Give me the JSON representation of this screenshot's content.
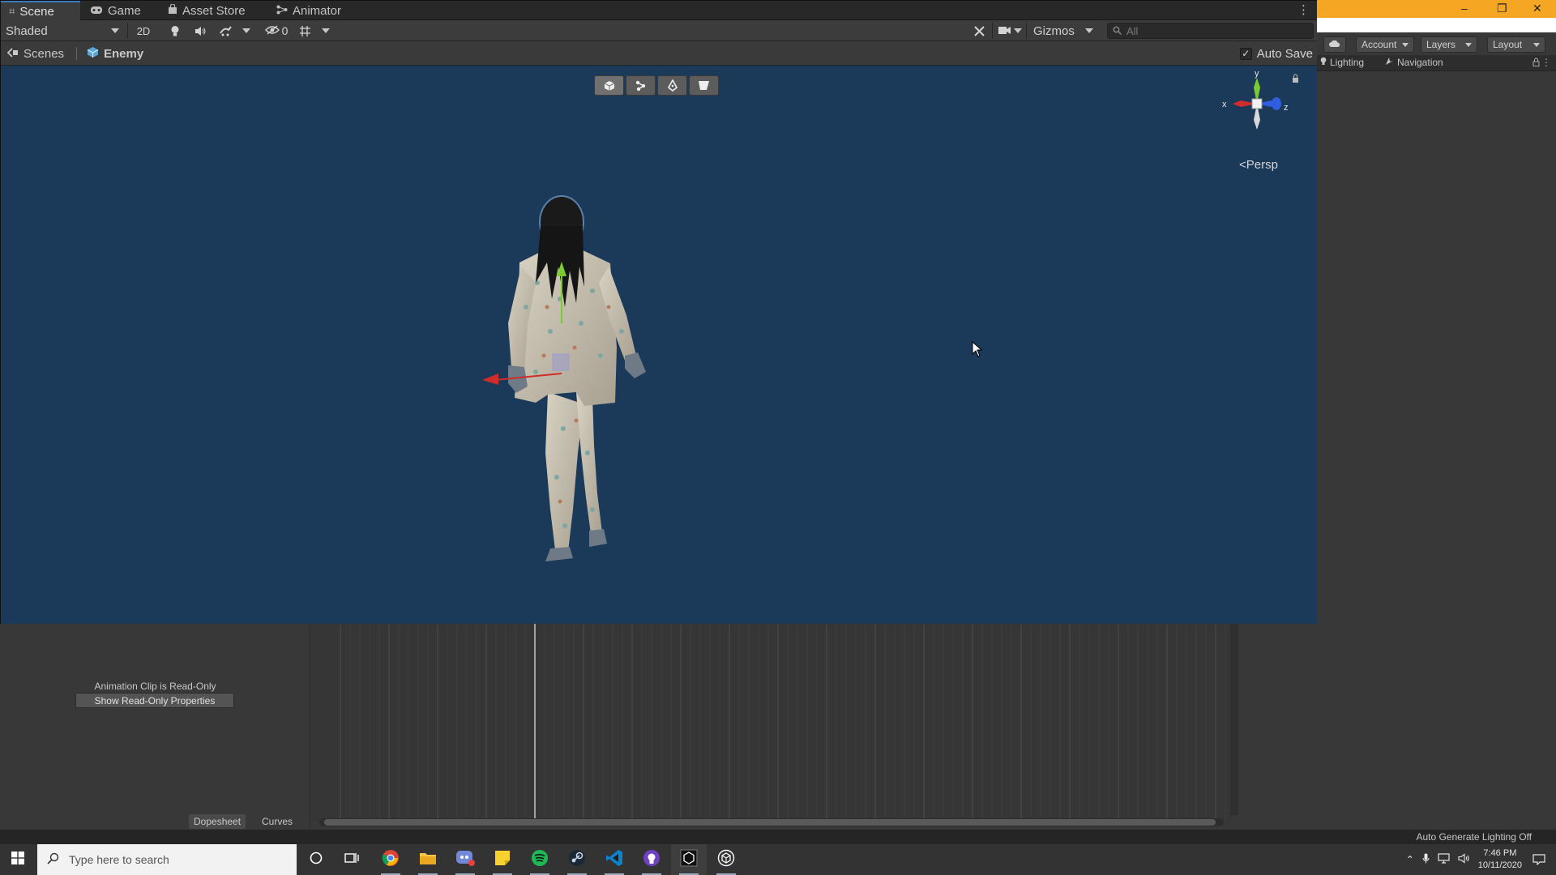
{
  "scene_tabs": [
    {
      "label": "Scene",
      "icon": "grid-icon"
    },
    {
      "label": "Game",
      "icon": "gamepad-icon"
    },
    {
      "label": "Asset Store",
      "icon": "bag-icon"
    },
    {
      "label": "Animator",
      "icon": "animator-icon"
    }
  ],
  "scene_toolbar": {
    "draw_mode": "Shaded",
    "two_d_label": "2D",
    "hidden_count": "0",
    "gizmos_label": "Gizmos",
    "search_placeholder": "All"
  },
  "breadcrumb": {
    "scenes_label": "Scenes",
    "prefab_label": "Enemy"
  },
  "auto_save": {
    "label": "Auto Save",
    "checked": true
  },
  "viewport": {
    "persp_label": "Persp",
    "axis_labels": {
      "x": "x",
      "y": "y",
      "z": "z"
    },
    "background_color": "#1b3a5a",
    "tools": [
      "box-tool-icon",
      "bones-tool-icon",
      "pen-tool-icon",
      "shape-tool-icon"
    ]
  },
  "right_panel": {
    "account_label": "Account",
    "layers_label": "Layers",
    "layout_label": "Layout",
    "tabs": [
      {
        "label": "Lighting",
        "icon": "bulb-icon"
      },
      {
        "label": "Navigation",
        "icon": "navigation-icon"
      }
    ],
    "accent_color": "#f5a623"
  },
  "animation": {
    "readonly_text": "Animation Clip is Read-Only",
    "show_readonly_button": "Show Read-Only Properties",
    "bottom_tabs": [
      "Dopesheet",
      "Curves"
    ]
  },
  "status_bar": {
    "text": "Auto Generate Lighting Off"
  },
  "taskbar": {
    "search_placeholder": "Type here to search",
    "apps": [
      "cortana-icon",
      "task-view-icon",
      "chrome-icon",
      "file-explorer-icon",
      "discord-icon",
      "sticky-notes-icon",
      "spotify-icon",
      "steam-icon",
      "vscode-icon",
      "github-desktop-icon",
      "unity-hub-icon",
      "unity-icon"
    ],
    "time": "7:46 PM",
    "date": "10/11/2020"
  }
}
